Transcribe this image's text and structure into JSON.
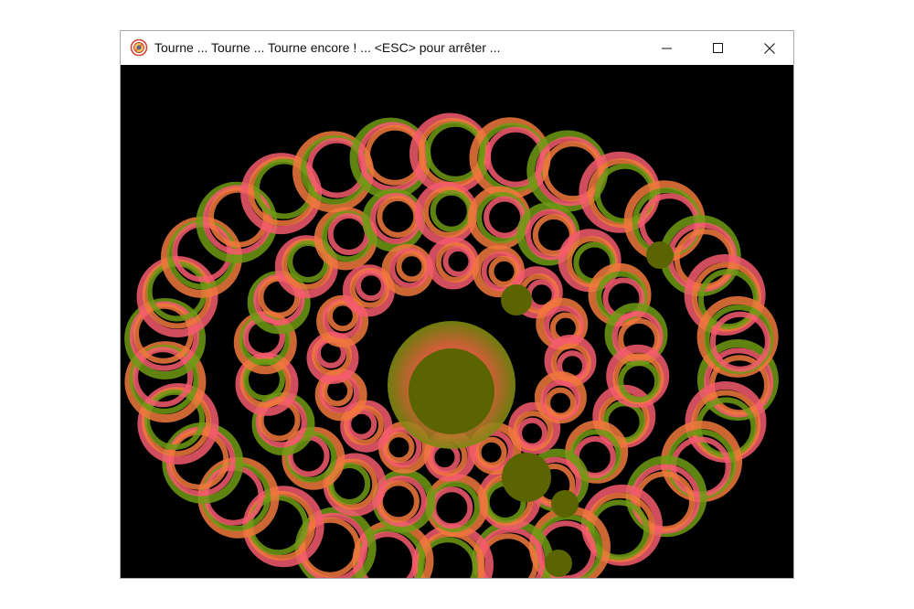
{
  "window": {
    "title": "Tourne ... Tourne ... Tourne encore ! ...  <ESC> pour arrêter ..."
  },
  "titlebar": {
    "app_icon": "python-turtle-icon",
    "minimize_icon": "minimize-icon",
    "maximize_icon": "maximize-icon",
    "close_icon": "close-icon"
  },
  "canvas": {
    "background_color": "#000000",
    "palette": {
      "pink": "#f55a6e",
      "orange": "#f0783c",
      "olive": "#5a6400",
      "green": "#6e9a14"
    }
  }
}
